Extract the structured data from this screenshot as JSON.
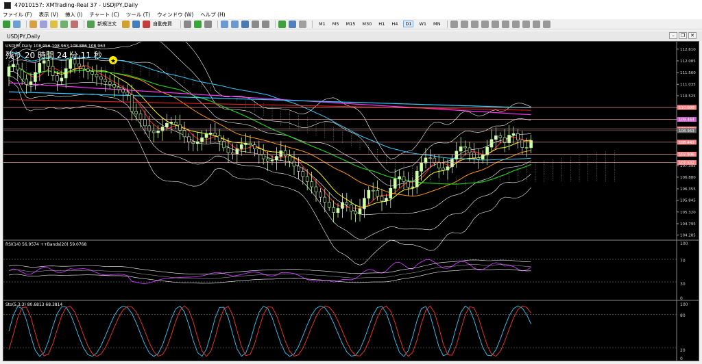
{
  "window": {
    "title": "47010157: XMTrading-Real 37 - USDJPY,Daily"
  },
  "menu": [
    "ファイル (F)",
    "表示 (V)",
    "挿入 (I)",
    "チャート (C)",
    "ツール (T)",
    "ウィンドウ (W)",
    "ヘルプ (H)"
  ],
  "toolbar": {
    "new_order": "新規注文",
    "auto_trade": "自動売買",
    "timeframes": [
      "M1",
      "M5",
      "M15",
      "M30",
      "H1",
      "H4",
      "D1",
      "W1",
      "MN"
    ],
    "active_timeframe": "D1"
  },
  "chart_tab": "USDJPY,Daily",
  "main_chart": {
    "header": "USDJPY,Daily 108.956 108.963 108.886 108.963",
    "countdown": "残り 20 時間 24 分 11 秒",
    "price_axis": [
      "112.610",
      "112.085",
      "111.560",
      "111.035",
      "110.525",
      "110.000",
      "109.480",
      "108.965",
      "108.445",
      "107.920",
      "107.395",
      "106.880",
      "106.355",
      "105.845",
      "105.320",
      "104.795",
      "104.285"
    ],
    "price_tags": [
      {
        "label": "110.000",
        "price": 110.0
      },
      {
        "label": "109.464",
        "price": 109.464
      },
      {
        "label": "109.039",
        "price": 109.039
      },
      {
        "label": "108.963",
        "price": 108.963
      },
      {
        "label": "108.443",
        "price": 108.443
      },
      {
        "label": "107.906",
        "price": 107.906
      },
      {
        "label": "107.532",
        "price": 107.532
      }
    ],
    "colors": {
      "magenta": "#ff33ff",
      "red": "#ff2020",
      "cyan": "#33ccff",
      "green": "#22cc22",
      "orange": "#ff9900",
      "yellow": "#ffff00",
      "candle": "#ccffaa"
    }
  },
  "rsi": {
    "header": "RSI(14) 56.9574  ++Bands(20) 59.0768",
    "levels": [
      "100",
      "70",
      "30",
      "0"
    ]
  },
  "stoch": {
    "header": "Sto(5,3,3) 80.6813 68.3814",
    "levels": [
      "100",
      "80",
      "20",
      "0"
    ]
  }
}
